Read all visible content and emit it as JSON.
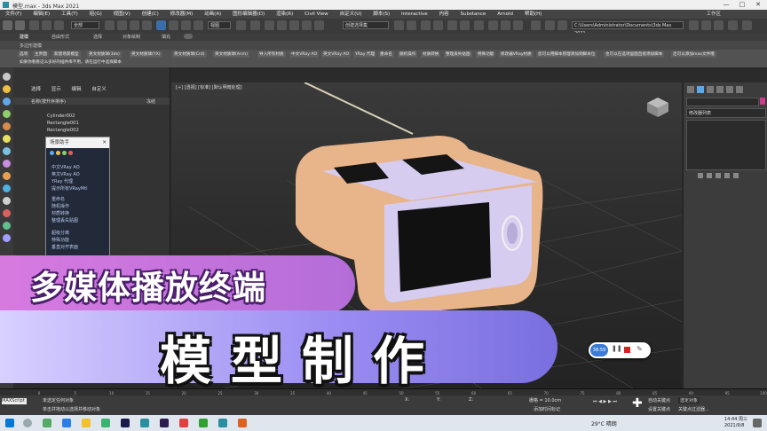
{
  "window": {
    "title": "模型.max - 3ds Max 2021",
    "minimize": "—",
    "maximize": "□",
    "close": "✕"
  },
  "menu": [
    "文件(F)",
    "编辑(E)",
    "工具(T)",
    "组(G)",
    "视图(V)",
    "创建(C)",
    "修改器(M)",
    "动画(A)",
    "图形编辑器(D)",
    "渲染(R)",
    "Civil View",
    "自定义(U)",
    "脚本(S)",
    "Interactive",
    "内容",
    "Substance",
    "Arnold",
    "帮助(H)"
  ],
  "workspace_label": "工作区",
  "toolbar": {
    "selection_filter": "全部",
    "view_dropdown": "视图",
    "selection_set": "创建选择集",
    "path": "C:\\Users\\Administrator\\Documents\\3ds Max 2021"
  },
  "ribbon_tabs": [
    "建模",
    "自由形式",
    "选择",
    "对象绘制",
    "填充"
  ],
  "ribbon_sub": "多边形建模",
  "ribbon_buttons": [
    "选项",
    "主界面",
    "新建场景模型",
    "英文材质球(3ds)",
    "英文材质球(YX)",
    "英文材质球(Crd)",
    "英文材质球(Arch)",
    "导入所有材质",
    "中文VRay AO",
    "英文VRay AO",
    "YRay 代理",
    "重命名",
    "随机操作",
    "材质转换",
    "整理丢失贴图",
    "特殊功能",
    "修改器VRay材质",
    "您可以用脚本管理添加到脚本位",
    "也可以在选项里面直接添加脚本",
    "还可以添加max文件哦"
  ],
  "ribbon_note": "如果你看看这么多好的插件库不用，请在运行中选择脚本",
  "scene_explorer": {
    "tabs": [
      "选择",
      "显示",
      "编辑",
      "自定义"
    ],
    "header_name": "名称(按升序排序)",
    "header_frozen": "冻结",
    "rows": [
      "Cylinder002",
      "Rectangle001",
      "Rectangle002"
    ]
  },
  "helper": {
    "title": "场景助手",
    "items": [
      "中文VRay AO",
      "英文VRay AO",
      "YRay 代理",
      "提示所有VRayMtl",
      "重命名",
      "随机操作",
      "材质转换",
      "整理丢失贴图",
      "超级分离",
      "特殊功能",
      "垂直对齐表面"
    ]
  },
  "viewport": {
    "label": "[+] [透视] [标准] [默认明暗处理]"
  },
  "command_panel": {
    "modifier_list": "修改器列表"
  },
  "status": {
    "selection": "未选定任何对象",
    "hint": "单击并拖动以选择并移动对象",
    "maxscript": "MAXScript 侦",
    "x_label": "X:",
    "y_label": "Y:",
    "z_label": "Z:",
    "grid": "栅格 = 10.0cm",
    "add_time_tag": "添加时间标记",
    "auto_key": "自动关键点",
    "set_key": "设置关键点",
    "selected_object": "选定对象",
    "key_filter": "关键点过滤器..."
  },
  "timeline_frames": [
    "0",
    "5",
    "10",
    "15",
    "20",
    "25",
    "30",
    "35",
    "40",
    "45",
    "50",
    "55",
    "60",
    "65",
    "70",
    "75",
    "80",
    "85",
    "90",
    "95",
    "100"
  ],
  "taskbar": {
    "weather": "29°C 晴朗",
    "time": "14:44 周三",
    "date": "2021/9/8"
  },
  "recorder": {
    "time": "38:59"
  },
  "overlay": {
    "line1": "多媒体播放终端",
    "line2": "模型制作"
  },
  "colors": {
    "device_body": "#e8b48a",
    "device_panel": "#d6ccf0",
    "banner1": "#c776dd",
    "banner2": "#9f90f3"
  }
}
